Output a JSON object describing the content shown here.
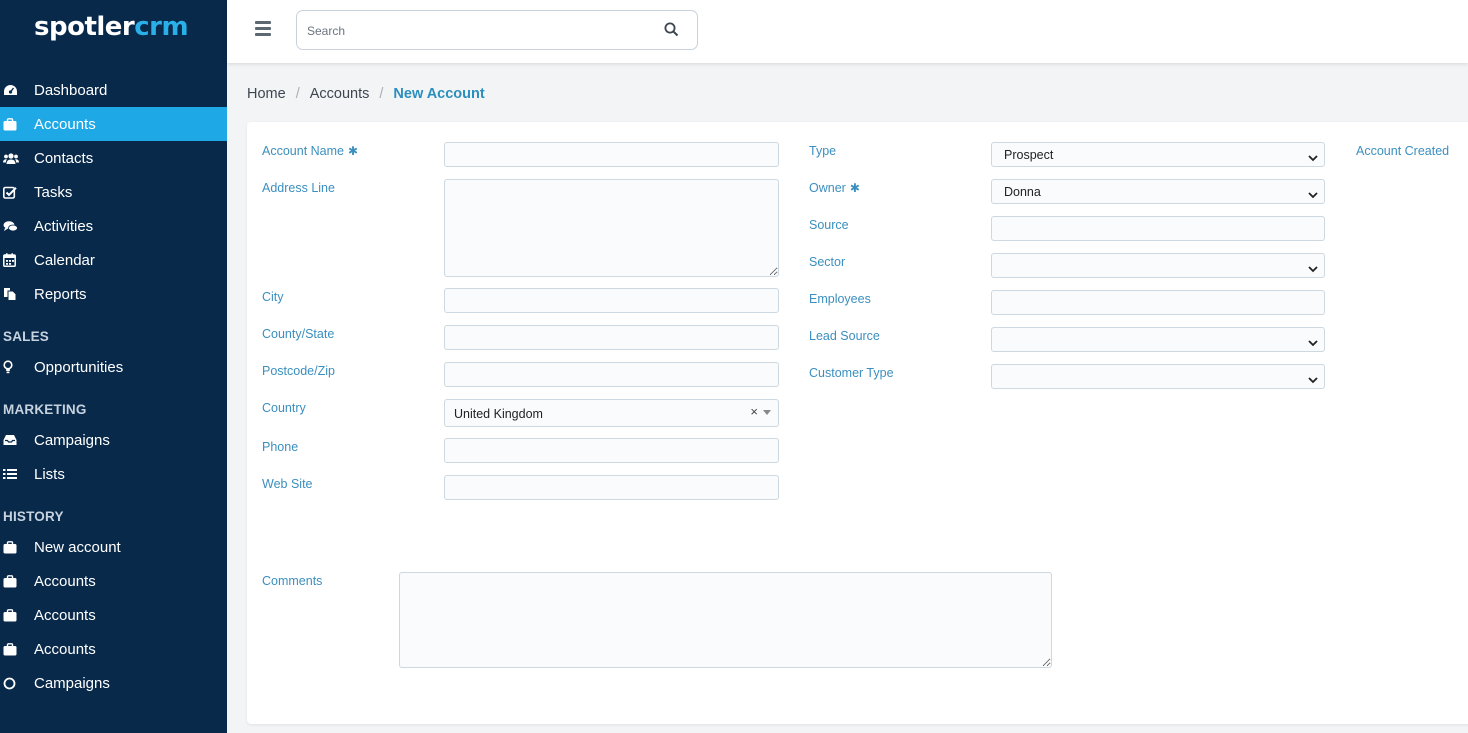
{
  "brand": {
    "part1": "spotler",
    "part2": "crm",
    "accent": "#29b0e8"
  },
  "sidebar": {
    "main_items": [
      {
        "label": "Dashboard",
        "icon": "dashboard-icon"
      },
      {
        "label": "Accounts",
        "icon": "briefcase-icon",
        "active": true
      },
      {
        "label": "Contacts",
        "icon": "users-icon"
      },
      {
        "label": "Tasks",
        "icon": "check-square-icon"
      },
      {
        "label": "Activities",
        "icon": "comments-icon"
      },
      {
        "label": "Calendar",
        "icon": "calendar-icon"
      },
      {
        "label": "Reports",
        "icon": "files-icon"
      }
    ],
    "sales_heading": "SALES",
    "sales_items": [
      {
        "label": "Opportunities",
        "icon": "lightbulb-icon"
      }
    ],
    "marketing_heading": "MARKETING",
    "marketing_items": [
      {
        "label": "Campaigns",
        "icon": "inbox-icon"
      },
      {
        "label": "Lists",
        "icon": "list-icon"
      }
    ],
    "history_heading": "HISTORY",
    "history_items": [
      {
        "label": "New account",
        "icon": "briefcase-icon"
      },
      {
        "label": "Accounts",
        "icon": "briefcase-icon"
      },
      {
        "label": "Accounts",
        "icon": "briefcase-icon"
      },
      {
        "label": "Accounts",
        "icon": "briefcase-icon"
      },
      {
        "label": "Campaigns",
        "icon": "circle-icon"
      }
    ]
  },
  "topbar": {
    "search_placeholder": "Search"
  },
  "breadcrumb": {
    "home": "Home",
    "accounts": "Accounts",
    "current": "New Account"
  },
  "form": {
    "left": {
      "account_name": {
        "label": "Account Name",
        "value": ""
      },
      "address_line": {
        "label": "Address Line",
        "value": ""
      },
      "city": {
        "label": "City",
        "value": ""
      },
      "county_state": {
        "label": "County/State",
        "value": ""
      },
      "postcode": {
        "label": "Postcode/Zip",
        "value": ""
      },
      "country": {
        "label": "Country",
        "value": "United Kingdom",
        "clear": "×"
      },
      "phone": {
        "label": "Phone",
        "value": ""
      },
      "website": {
        "label": "Web Site",
        "value": ""
      }
    },
    "right": {
      "type": {
        "label": "Type",
        "value": "Prospect"
      },
      "owner": {
        "label": "Owner",
        "value": "Donna"
      },
      "source": {
        "label": "Source",
        "value": ""
      },
      "sector": {
        "label": "Sector",
        "value": ""
      },
      "employees": {
        "label": "Employees",
        "value": ""
      },
      "lead_source": {
        "label": "Lead Source",
        "value": ""
      },
      "customer_type": {
        "label": "Customer Type",
        "value": ""
      }
    },
    "account_created_label": "Account Created",
    "comments": {
      "label": "Comments",
      "value": ""
    },
    "required_marker": "✱"
  }
}
